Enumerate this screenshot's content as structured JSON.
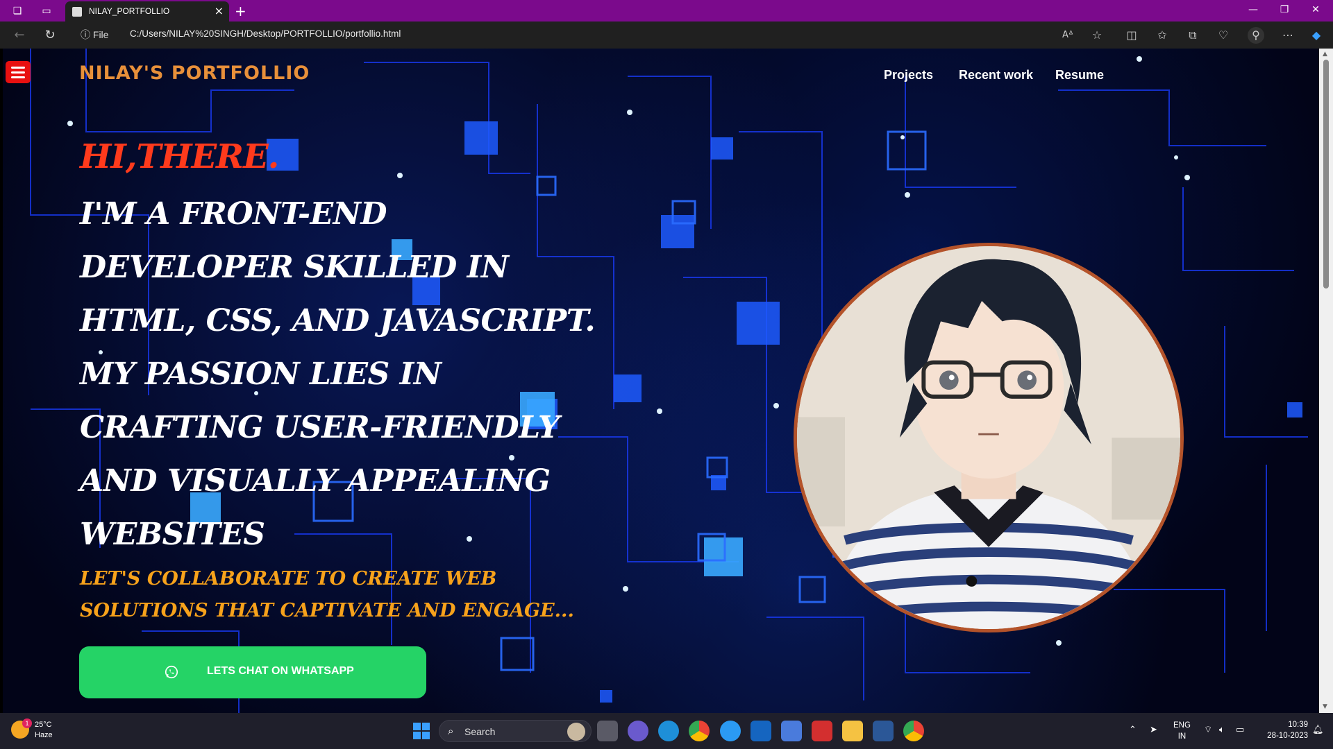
{
  "browser": {
    "tab_title": "NILAY_PORTFOLLIO",
    "url_scheme_label": "File",
    "url": "C:/Users/NILAY%20SINGH/Desktop/PORTFOLLIO/portfollio.html"
  },
  "page": {
    "brand": "NILAY'S PORTFOLLIO",
    "nav": [
      "Projects",
      "Recent work",
      "Resume"
    ],
    "greeting": "HI,THERE.",
    "intro": "I'M A FRONT-END DEVELOPER SKILLED IN HTML, CSS, AND JAVASCRIPT. MY PASSION LIES IN CRAFTING USER-FRIENDLY AND VISUALLY APPEALING WEBSITES",
    "collab": "LET'S COLLABORATE TO CREATE WEB SOLUTIONS THAT CAPTIVATE AND ENGAGE...",
    "whatsapp_button": "LETS CHAT ON WHATSAPP"
  },
  "colors": {
    "titlebar": "#7b0a8c",
    "greeting": "#ff3a1c",
    "collab": "#f7a21b",
    "whatsapp": "#25d366",
    "avatar_border": "#b4532a"
  },
  "taskbar": {
    "weather_temp": "25°C",
    "weather_desc": "Haze",
    "weather_badge": "1",
    "search_placeholder": "Search",
    "lang": "ENG",
    "region": "IN",
    "time": "10:39",
    "date": "28-10-2023"
  }
}
